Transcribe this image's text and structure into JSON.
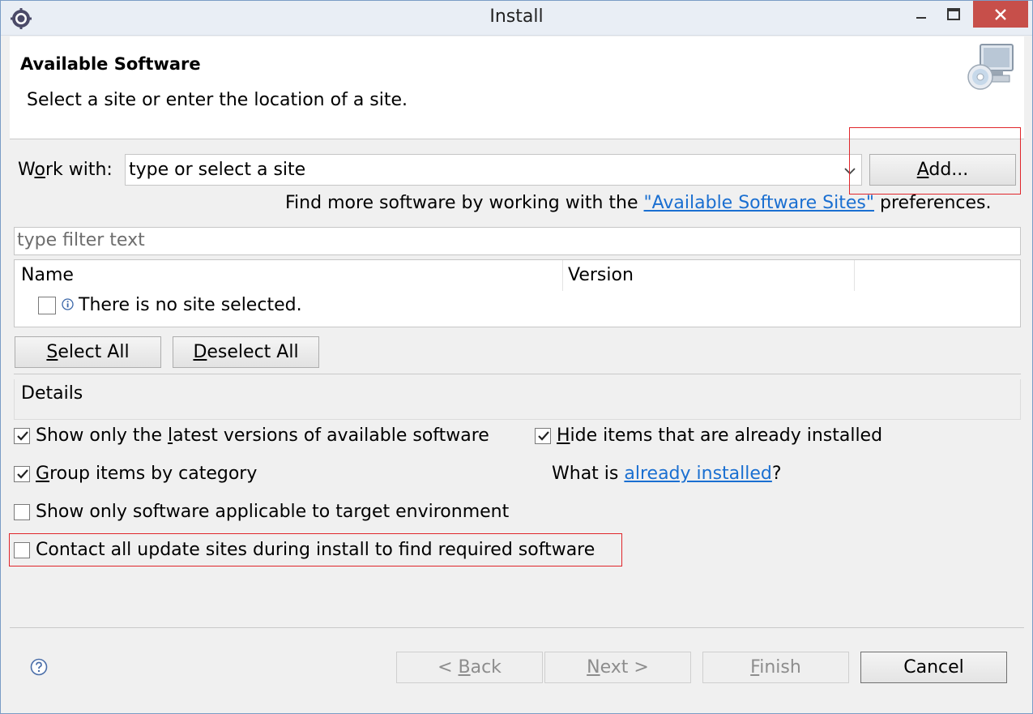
{
  "window": {
    "title": "Install"
  },
  "header": {
    "title": "Available Software",
    "description": "Select a site or enter the location of a site.",
    "icon": "monitor-cd-icon"
  },
  "work_with": {
    "label_prefix": "W",
    "label_underlined": "o",
    "label_suffix": "rk with:",
    "value": "type or select a site"
  },
  "add_button": {
    "label_underlined": "A",
    "label_rest": "dd..."
  },
  "find_more": {
    "prefix": "Find more software by working with the ",
    "link": "\"Available Software Sites\"",
    "suffix": " preferences."
  },
  "filter": {
    "placeholder": "type filter text"
  },
  "table": {
    "columns": [
      "Name",
      "Version"
    ],
    "rows": [
      {
        "label": "There is no site selected.",
        "checked": false,
        "icon": "info-icon"
      }
    ]
  },
  "selection_buttons": {
    "select_all_u": "S",
    "select_all_rest": "elect All",
    "deselect_all_u": "D",
    "deselect_all_rest": "eselect All"
  },
  "details": {
    "label": "Details"
  },
  "options": {
    "latest": {
      "before": "Show only the ",
      "u": "l",
      "after": "atest versions of available software",
      "checked": true
    },
    "hide": {
      "before": "",
      "u": "H",
      "after": "ide items that are already installed",
      "checked": true
    },
    "group": {
      "before": "",
      "u": "G",
      "after": "roup items by category",
      "checked": true
    },
    "applicable": {
      "text": "Show only software applicable to target environment",
      "checked": false
    },
    "contact": {
      "text": "Contact all update sites during install to find required software",
      "checked": false
    }
  },
  "what_is": {
    "prefix": "What is ",
    "link": "already installed",
    "suffix": "?"
  },
  "footer": {
    "back_prefix": "< ",
    "back_u": "B",
    "back_rest": "ack",
    "next_u": "N",
    "next_rest": "ext >",
    "finish_u": "F",
    "finish_rest": "inish",
    "cancel": "Cancel"
  },
  "colors": {
    "highlight": "#e0262b",
    "link": "#1a6fd1",
    "close_button": "#c74f4a"
  }
}
